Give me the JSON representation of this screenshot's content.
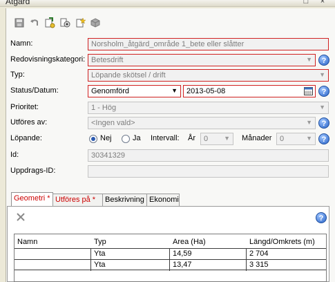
{
  "window": {
    "title": "Åtgärd"
  },
  "toolbar": {
    "items": [
      "save-icon",
      "undo-icon",
      "pin-edit-icon",
      "view-icon",
      "new-item-icon",
      "cube-icon"
    ]
  },
  "form": {
    "namn": {
      "label": "Namn:",
      "value": "Norsholm_åtgärd_område 1_bete eller slåtter"
    },
    "redovisning": {
      "label": "Redovisningskategori:",
      "value": "Betesdrift"
    },
    "typ": {
      "label": "Typ:",
      "value": "Löpande skötsel / drift"
    },
    "status": {
      "label": "Status/Datum:",
      "value": "Genomförd",
      "date": "2013-05-08"
    },
    "prioritet": {
      "label": "Prioritet:",
      "value": "1 - Hög"
    },
    "utfores": {
      "label": "Utföres av:",
      "value": "<Ingen vald>"
    },
    "lopande": {
      "label": "Löpande:",
      "nej": "Nej",
      "ja": "Ja",
      "selected": "Nej",
      "intervall_label": "Intervall:",
      "ar_label": "År",
      "ar_value": "0",
      "manader_label": "Månader",
      "manader_value": "0"
    },
    "id": {
      "label": "Id:",
      "value": "30341329"
    },
    "uppdrag": {
      "label": "Uppdrags-ID:",
      "value": ""
    }
  },
  "tabs": [
    {
      "label": "Geometri *",
      "required": true,
      "active": true
    },
    {
      "label": "Utföres på *",
      "required": true,
      "active": false
    },
    {
      "label": "Beskrivning",
      "required": false,
      "active": false
    },
    {
      "label": "Ekonomi",
      "required": false,
      "active": false
    }
  ],
  "table": {
    "columns": [
      "Namn",
      "Typ",
      "Area (Ha)",
      "Längd/Omkrets (m)"
    ],
    "rows": [
      [
        "",
        "Yta",
        "14,59",
        "2 704"
      ],
      [
        "",
        "Yta",
        "13,47",
        "3 315"
      ]
    ]
  },
  "colors": {
    "required_border": "#d02020",
    "required_tab_text": "#cc0000",
    "accent": "#2a64c8"
  }
}
